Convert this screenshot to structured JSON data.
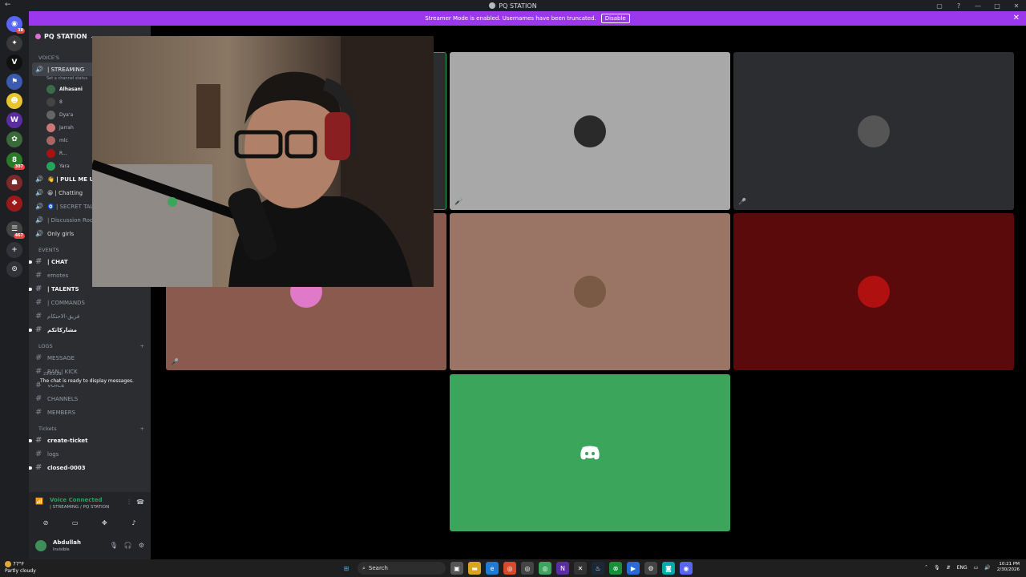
{
  "window": {
    "title": "PQ STATION"
  },
  "banner": {
    "text": "Streamer Mode is enabled. Usernames have been truncated.",
    "disable_label": "Disable"
  },
  "rail": {
    "badges": [
      "38",
      "307",
      "467"
    ]
  },
  "server": {
    "name": "PQ STATION"
  },
  "sidebar": {
    "voice_category": "VOICE'S",
    "active_channel": "| STREAMING",
    "active_status": "Set a channel status",
    "members": [
      "Alhasani",
      "8",
      "Dya'a",
      "Jarrah",
      "mlc",
      "R...",
      "Yara"
    ],
    "voice_channels": [
      "👋 | PULL ME UP",
      "😀 | Chatting",
      "🧿 | SECRET TALK",
      "| Discussion Room",
      "Only girls"
    ],
    "events_category": "EVENTS",
    "event_channels": [
      {
        "name": "| CHAT",
        "bold": true
      },
      {
        "name": "emotes",
        "bold": false
      },
      {
        "name": "| TALENTS",
        "bold": true
      },
      {
        "name": "| COMMANDS",
        "bold": false
      },
      {
        "name": "فريق-الاحتكام",
        "bold": false
      },
      {
        "name": "مشاركاتكم",
        "bold": true
      }
    ],
    "logs_category": "LOGS",
    "log_channels": [
      "MESSAGE",
      "BAN | KICK",
      "VOICE",
      "CHANNELS",
      "MEMBERS"
    ],
    "chat_ready": "The chat is ready to display messages.",
    "chat_time": "23:13:29",
    "tickets_category": "Tickets",
    "ticket_channels": [
      {
        "name": "create-ticket",
        "bold": true
      },
      {
        "name": "logs",
        "bold": false
      },
      {
        "name": "closed-0003",
        "bold": true
      }
    ]
  },
  "voice_panel": {
    "title": "Voice Connected",
    "subtitle": "| STREAMING / PQ STATION"
  },
  "user_panel": {
    "name": "Abdullah",
    "status": "Invisible"
  },
  "stage": {
    "tiles": [
      {
        "color": "#2b2d31",
        "border": "#23a55a"
      },
      {
        "color": "#a8a8a8",
        "avatar": "#2a2a2a"
      },
      {
        "color": "#2b2d31",
        "avatar": "#555555"
      },
      {
        "color": "#8a5a4e",
        "avatar": "#e07ac8"
      },
      {
        "color": "#9a7565",
        "avatar": "#7a5a45"
      },
      {
        "color": "#5a0a0a",
        "avatar": "#b01010"
      },
      {
        "color": "#3ba55c"
      }
    ]
  },
  "taskbar": {
    "weather_temp": "77°F",
    "weather_desc": "Partly cloudy",
    "search_label": "Search",
    "lang": "ENG",
    "time": "10:21 PM",
    "date": "2/30/2026"
  }
}
